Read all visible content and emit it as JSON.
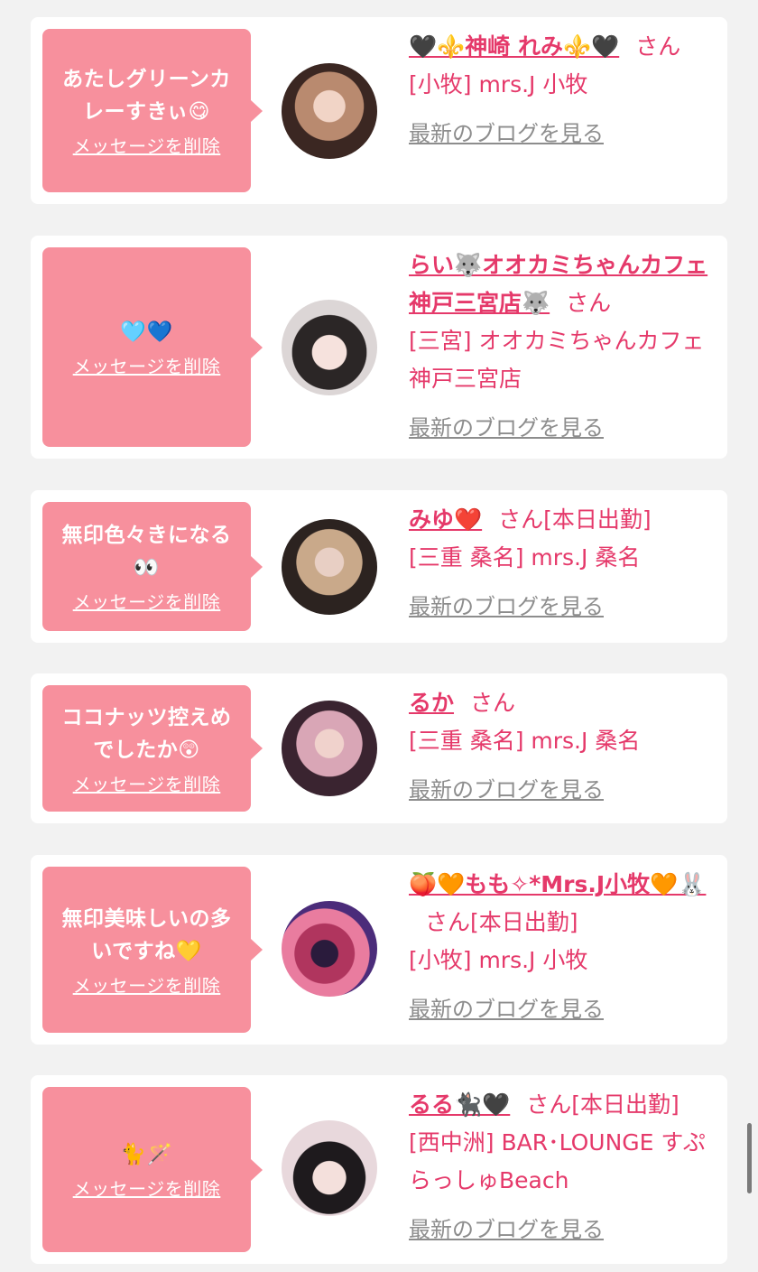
{
  "cards": [
    {
      "message": "あたしグリーンカレーすきぃ😋",
      "delete_label": "メッセージを削除",
      "name": "🖤⚜️神崎 れみ⚜️🖤",
      "san": "さん",
      "status": "",
      "shop": "[小牧] mrs.J 小牧",
      "blog_label": "最新のブログを見る",
      "avatar_colors": [
        "#b98a6f",
        "#3b2722"
      ]
    },
    {
      "message": "🩵💙",
      "delete_label": "メッセージを削除",
      "name": "らい🐺オオカミちゃんカフェ神戸三宮店🐺",
      "san": "さん",
      "status": "",
      "shop": "[三宮] オオカミちゃんカフェ神戸三宮店",
      "blog_label": "最新のブログを見る",
      "avatar_colors": [
        "#dcd6d6",
        "#2b2626"
      ]
    },
    {
      "message": "無印色々きになる👀",
      "delete_label": "メッセージを削除",
      "name": "みゆ❤️",
      "san": "さん",
      "status": "[本日出勤]",
      "shop": "[三重 桑名] mrs.J 桑名",
      "blog_label": "最新のブログを見る",
      "avatar_colors": [
        "#c9a98a",
        "#2c2320"
      ]
    },
    {
      "message": "ココナッツ控えめでしたか😲",
      "delete_label": "メッセージを削除",
      "name": "るか",
      "san": "さん",
      "status": "",
      "shop": "[三重 桑名] mrs.J 桑名",
      "blog_label": "最新のブログを見る",
      "avatar_colors": [
        "#d9a6b6",
        "#3a2430"
      ]
    },
    {
      "message": "無印美味しいの多いですね💛",
      "delete_label": "メッセージを削除",
      "name": "🍑🧡もも✧*Mrs.J小牧🧡🐰",
      "san": "さん",
      "status": "[本日出勤]",
      "shop": "[小牧] mrs.J 小牧",
      "blog_label": "最新のブログを見る",
      "avatar_colors": [
        "#e97c9f",
        "#4b2c7a"
      ]
    },
    {
      "message": "🐈🪄",
      "delete_label": "メッセージを削除",
      "name": "るる🐈‍⬛🖤",
      "san": "さん",
      "status": "[本日出勤]",
      "shop": "[西中洲] BAR･LOUNGE すぷらっしゅBeach",
      "blog_label": "最新のブログを見る",
      "avatar_colors": [
        "#e8d8dc",
        "#1e1a1d"
      ]
    }
  ],
  "colors": {
    "background": "#f2f2f2",
    "bubble": "#f7909d",
    "name_text": "#e5396a",
    "blog_link": "#8d8d8d"
  }
}
